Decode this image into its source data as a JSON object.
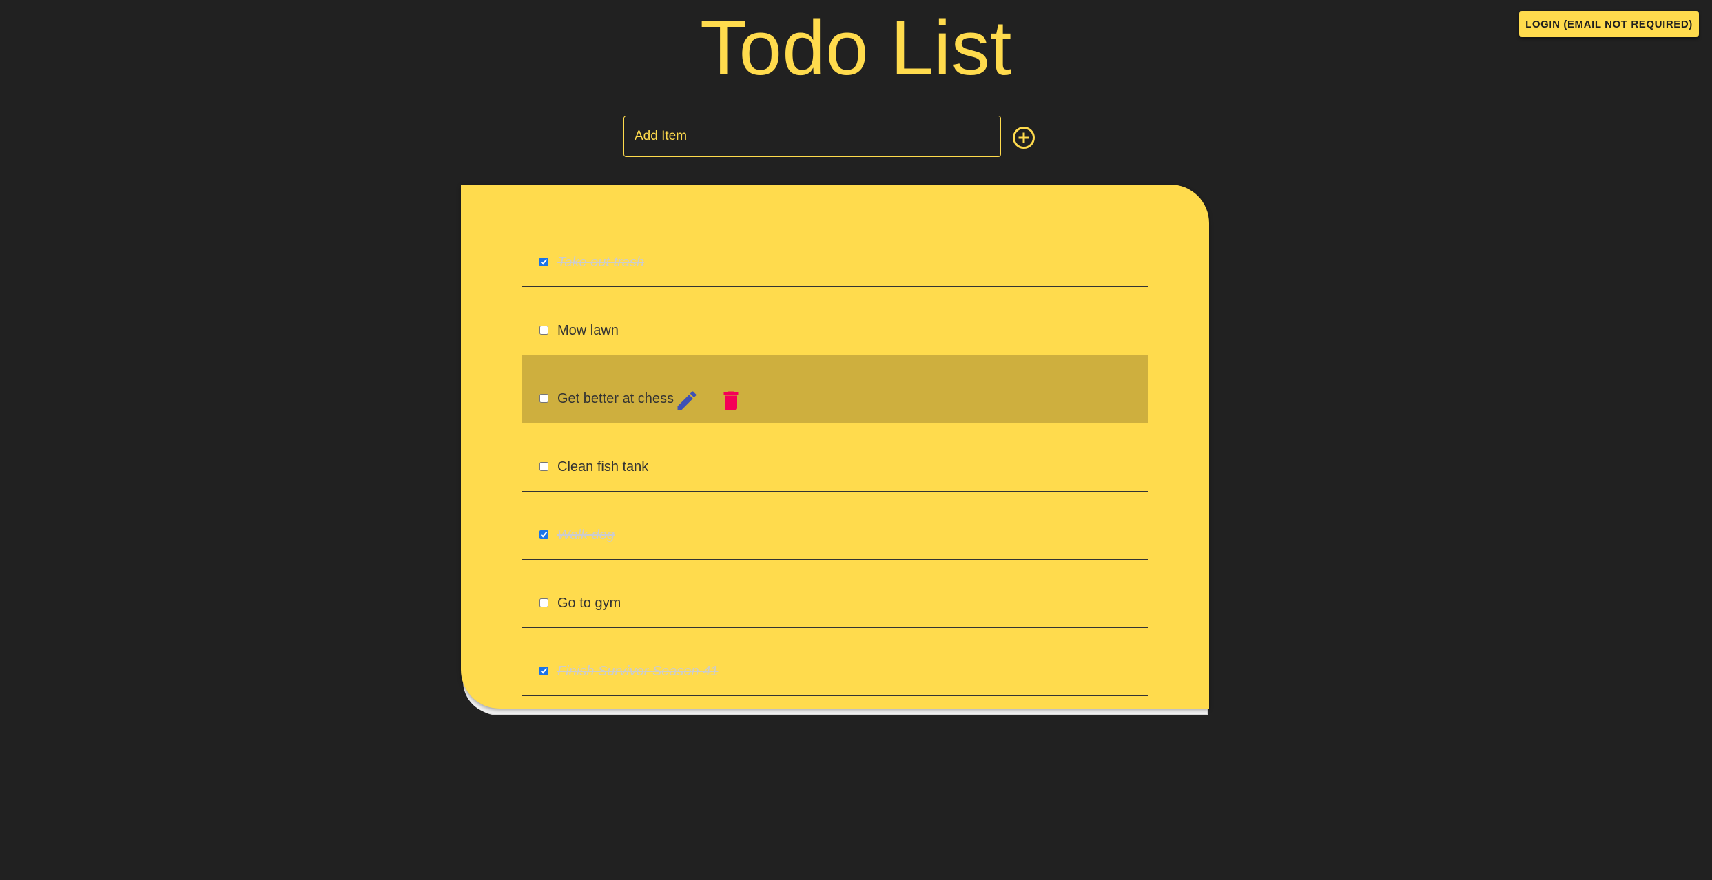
{
  "header": {
    "title": "Todo List",
    "login_label": "LOGIN (EMAIL NOT REQUIRED)"
  },
  "add_item": {
    "placeholder": "Add Item",
    "button_icon": "add-circle-icon"
  },
  "todos": [
    {
      "text": "Take out trash",
      "done": true
    },
    {
      "text": "Mow lawn",
      "done": false
    },
    {
      "text": "Get better at chess",
      "done": false,
      "hovered": true
    },
    {
      "text": "Clean fish tank",
      "done": false
    },
    {
      "text": "Walk dog",
      "done": true
    },
    {
      "text": "Go to gym",
      "done": false
    },
    {
      "text": "Finish Survivor Season 41",
      "done": true
    }
  ],
  "row_actions": {
    "edit_icon": "pencil-icon",
    "delete_icon": "trash-icon"
  },
  "colors": {
    "background": "#212121",
    "accent": "#FFDB4D",
    "row_hover": "#CEAF3E",
    "edit": "#3F51B5",
    "delete": "#F50057"
  }
}
